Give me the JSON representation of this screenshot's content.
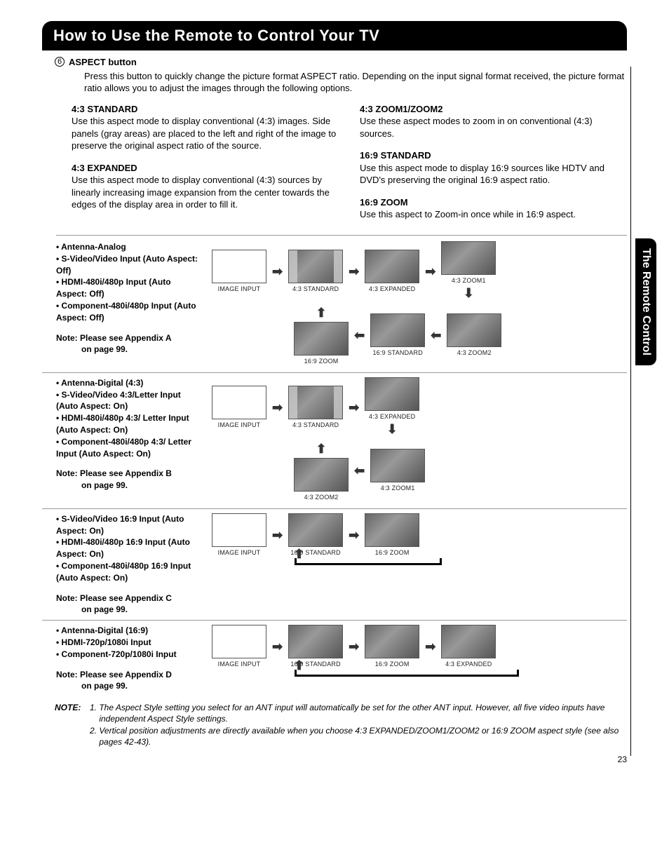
{
  "title": "How to Use the Remote to Control Your TV",
  "side_tab": "The Remote Control",
  "page_number": "23",
  "intro": {
    "num": "6",
    "heading": "ASPECT button",
    "desc": "Press this button to quickly change the picture format ASPECT ratio. Depending on the input signal format received, the picture format ratio allows you to adjust the images through the following options."
  },
  "modes_left": [
    {
      "head": "4:3 STANDARD",
      "desc": "Use this aspect mode to display conventional (4:3) images. Side panels (gray areas) are placed to the left and right of the image to preserve the original aspect ratio of the source."
    },
    {
      "head": "4:3 EXPANDED",
      "desc": "Use this aspect mode to display conventional (4:3) sources by linearly increasing image expansion from the center towards the edges of the display area in order to fill it."
    }
  ],
  "modes_right": [
    {
      "head": "4:3 ZOOM1/ZOOM2",
      "desc": "Use these aspect modes to zoom in on conventional (4:3) sources."
    },
    {
      "head": "16:9 STANDARD",
      "desc": "Use this aspect mode to display 16:9 sources like HDTV and DVD's preserving the original 16:9 aspect ratio."
    },
    {
      "head": "16:9 ZOOM",
      "desc": "Use this aspect to Zoom-in once while in 16:9 aspect."
    }
  ],
  "sections": [
    {
      "bullets": [
        "Antenna-Analog",
        "S-Video/Video Input (Auto Aspect: Off)",
        "HDMI-480i/480p Input (Auto Aspect: Off)",
        "Component-480i/480p Input (Auto Aspect: Off)"
      ],
      "note1": "Note:  Please see Appendix A",
      "note2": "on page 99.",
      "labels": {
        "input": "IMAGE INPUT",
        "a": "4:3 STANDARD",
        "b": "4:3 EXPANDED",
        "c": "4:3 ZOOM1",
        "d": "4:3 ZOOM2",
        "e": "16:9 STANDARD",
        "f": "16:9 ZOOM"
      }
    },
    {
      "bullets": [
        "Antenna-Digital (4:3)",
        "S-Video/Video 4:3/Letter Input (Auto Aspect: On)",
        "HDMI-480i/480p 4:3/ Letter Input (Auto Aspect: On)",
        "Component-480i/480p 4:3/ Letter Input (Auto Aspect: On)"
      ],
      "note1": "Note:  Please see Appendix B",
      "note2": "on page 99.",
      "labels": {
        "input": "IMAGE INPUT",
        "a": "4:3 STANDARD",
        "b": "4:3 EXPANDED",
        "c": "4:3 ZOOM1",
        "d": "4:3 ZOOM2"
      }
    },
    {
      "bullets": [
        "S-Video/Video 16:9 Input (Auto Aspect: On)",
        "HDMI-480i/480p 16:9 Input (Auto Aspect: On)",
        "Component-480i/480p 16:9 Input (Auto Aspect: On)"
      ],
      "note1": "Note:  Please see Appendix C",
      "note2": "on page 99.",
      "labels": {
        "input": "IMAGE INPUT",
        "a": "16:9 STANDARD",
        "b": "16:9 ZOOM"
      }
    },
    {
      "bullets": [
        "Antenna-Digital (16:9)",
        "HDMI-720p/1080i Input",
        "Component-720p/1080i Input"
      ],
      "note1": "Note:  Please see Appendix D",
      "note2": "on page 99.",
      "labels": {
        "input": "IMAGE INPUT",
        "a": "16:9 STANDARD",
        "b": "16:9 ZOOM",
        "c": "4:3 EXPANDED"
      }
    }
  ],
  "final_note": {
    "head": "NOTE:",
    "items": [
      "The Aspect Style setting you select for an ANT input will automatically be set for the other ANT input. However, all five video inputs have independent Aspect Style settings.",
      "Vertical position adjustments are directly available when you choose 4:3 EXPANDED/ZOOM1/ZOOM2 or 16:9 ZOOM aspect style (see also pages 42-43)."
    ]
  }
}
